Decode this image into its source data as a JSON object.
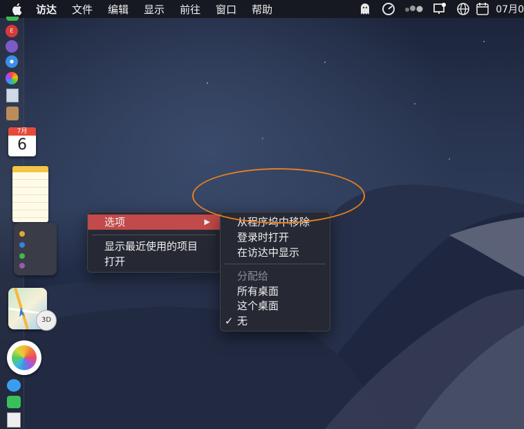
{
  "menubar": {
    "items": [
      "访达",
      "文件",
      "编辑",
      "显示",
      "前往",
      "窗口",
      "帮助"
    ],
    "date_text": "07月0"
  },
  "dock": {
    "calendar_month": "7月",
    "calendar_day": "6",
    "maps_badge": "3D"
  },
  "context_menu": {
    "items": {
      "options": "选项",
      "recent": "显示最近使用的项目",
      "open": "打开"
    },
    "arrow": "▶"
  },
  "submenu": {
    "remove_from_dock": "从程序坞中移除",
    "open_at_login": "登录时打开",
    "show_in_finder": "在访达中显示",
    "assign_to_header": "分配给",
    "all_desktops": "所有桌面",
    "this_desktop": "这个桌面",
    "none": "无",
    "checkmark": "✓"
  },
  "colors": {
    "highlight": "#c24a4a",
    "annotation": "#e67e22"
  }
}
